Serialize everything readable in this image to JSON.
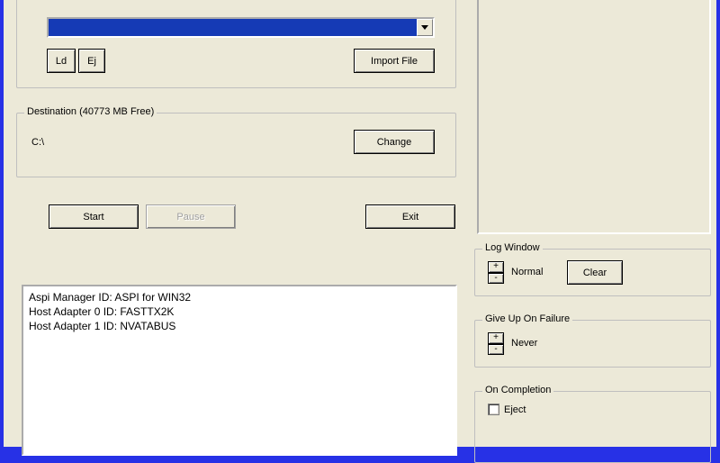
{
  "source": {
    "dropdown_value": "",
    "ld_label": "Ld",
    "ej_label": "Ej",
    "import_label": "Import File"
  },
  "destination": {
    "group_label": "Destination  (40773 MB Free)",
    "path": "C:\\",
    "change_label": "Change"
  },
  "actions": {
    "start_label": "Start",
    "pause_label": "Pause",
    "exit_label": "Exit"
  },
  "log": {
    "lines": [
      "Aspi Manager ID: ASPI for WIN32",
      "Host Adapter 0 ID: FASTTX2K",
      "Host Adapter 1 ID: NVATABUS"
    ]
  },
  "log_window": {
    "group_label": "Log Window",
    "value_label": "Normal",
    "clear_label": "Clear"
  },
  "give_up": {
    "group_label": "Give Up On Failure",
    "value_label": "Never"
  },
  "on_completion": {
    "group_label": "On Completion",
    "eject_label": "Eject"
  }
}
